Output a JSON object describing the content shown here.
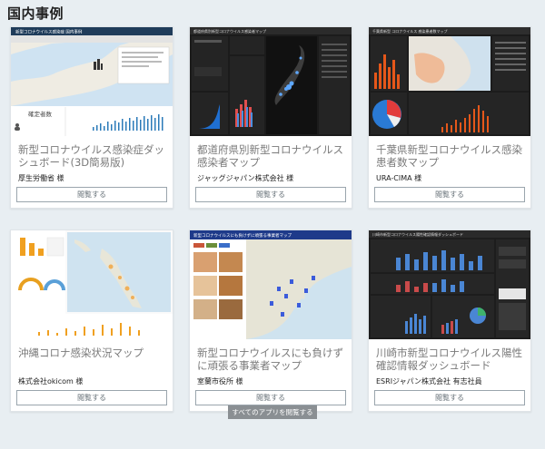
{
  "page": {
    "heading": "国内事例",
    "all_apps_label": "すべてのアプリを閲覧する"
  },
  "colors": {
    "background": "#e8eef2",
    "button_border": "#9aa5ad",
    "title_gray": "#7a7a7a",
    "all_button": "#8a8f93"
  },
  "cards": [
    {
      "title": "新型コロナウイルス感染症ダッシュボード(3D簡易版)",
      "org": "厚生労働省 様",
      "button": "閲覧する",
      "thumb": {
        "header_text": "新型コロナウイルス感染症 国内事例",
        "panel_label": "確定者数"
      }
    },
    {
      "title": "都道府県別新型コロナウイルス感染者マップ",
      "org": "ジャッグジャパン株式会社 様",
      "button": "閲覧する",
      "thumb": {
        "header_text": "都道府県別新型コロナウイルス感染者マップ"
      }
    },
    {
      "title": "千葉県新型コロナウイルス感染患者数マップ",
      "org": "URA-CIMA 様",
      "button": "閲覧する",
      "thumb": {
        "header_text": "千葉県新型 コロナウイルス 感染患者数マップ"
      }
    },
    {
      "title": "沖縄コロナ感染状況マップ",
      "org": "株式会社okicom 様",
      "button": "閲覧する",
      "thumb": {
        "header_text": ""
      }
    },
    {
      "title": "新型コロナウイルスにも負けずに頑張る事業者マップ",
      "org": "室蘭市役所 様",
      "button": "閲覧する",
      "thumb": {
        "header_text": "新型コロナウイルスにも負けずに頑張る事業者マップ"
      }
    },
    {
      "title": "川崎市新型コロナウイルス陽性確認情報ダッシュボード",
      "org": "ESRIジャパン株式会社 有志社員",
      "button": "閲覧する",
      "thumb": {
        "header_text": "川崎市新型コロナウイルス陽性確認情報ダッシュボード"
      }
    }
  ]
}
